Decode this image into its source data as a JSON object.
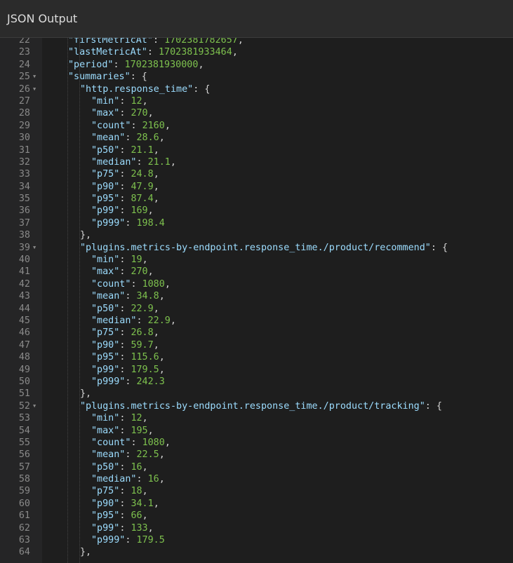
{
  "panel": {
    "title": "JSON Output"
  },
  "lines": [
    {
      "num": "22",
      "parts": [
        {
          "t": "\"firstMetricAt\"",
          "c": "k"
        },
        {
          "t": ": ",
          "c": "p"
        },
        {
          "t": "1702381782657",
          "c": "n"
        },
        {
          "t": ",",
          "c": "p"
        }
      ]
    },
    {
      "num": "23",
      "parts": [
        {
          "t": "\"lastMetricAt\"",
          "c": "k"
        },
        {
          "t": ": ",
          "c": "p"
        },
        {
          "t": "1702381933464",
          "c": "n"
        },
        {
          "t": ",",
          "c": "p"
        }
      ]
    },
    {
      "num": "24",
      "parts": [
        {
          "t": "\"period\"",
          "c": "k"
        },
        {
          "t": ": ",
          "c": "p"
        },
        {
          "t": "1702381930000",
          "c": "n"
        },
        {
          "t": ",",
          "c": "p"
        }
      ]
    },
    {
      "num": "25",
      "fold": true,
      "parts": [
        {
          "t": "\"summaries\"",
          "c": "k"
        },
        {
          "t": ": {",
          "c": "p"
        }
      ]
    },
    {
      "num": "26",
      "fold": true,
      "parts": [
        {
          "t": "\"http.response_time\"",
          "c": "k"
        },
        {
          "t": ": {",
          "c": "p"
        }
      ]
    },
    {
      "num": "27",
      "parts": [
        {
          "t": "\"min\"",
          "c": "k"
        },
        {
          "t": ": ",
          "c": "p"
        },
        {
          "t": "12",
          "c": "n"
        },
        {
          "t": ",",
          "c": "p"
        }
      ]
    },
    {
      "num": "28",
      "parts": [
        {
          "t": "\"max\"",
          "c": "k"
        },
        {
          "t": ": ",
          "c": "p"
        },
        {
          "t": "270",
          "c": "n"
        },
        {
          "t": ",",
          "c": "p"
        }
      ]
    },
    {
      "num": "29",
      "parts": [
        {
          "t": "\"count\"",
          "c": "k"
        },
        {
          "t": ": ",
          "c": "p"
        },
        {
          "t": "2160",
          "c": "n"
        },
        {
          "t": ",",
          "c": "p"
        }
      ]
    },
    {
      "num": "30",
      "parts": [
        {
          "t": "\"mean\"",
          "c": "k"
        },
        {
          "t": ": ",
          "c": "p"
        },
        {
          "t": "28.6",
          "c": "n"
        },
        {
          "t": ",",
          "c": "p"
        }
      ]
    },
    {
      "num": "31",
      "parts": [
        {
          "t": "\"p50\"",
          "c": "k"
        },
        {
          "t": ": ",
          "c": "p"
        },
        {
          "t": "21.1",
          "c": "n"
        },
        {
          "t": ",",
          "c": "p"
        }
      ]
    },
    {
      "num": "32",
      "parts": [
        {
          "t": "\"median\"",
          "c": "k"
        },
        {
          "t": ": ",
          "c": "p"
        },
        {
          "t": "21.1",
          "c": "n"
        },
        {
          "t": ",",
          "c": "p"
        }
      ]
    },
    {
      "num": "33",
      "parts": [
        {
          "t": "\"p75\"",
          "c": "k"
        },
        {
          "t": ": ",
          "c": "p"
        },
        {
          "t": "24.8",
          "c": "n"
        },
        {
          "t": ",",
          "c": "p"
        }
      ]
    },
    {
      "num": "34",
      "parts": [
        {
          "t": "\"p90\"",
          "c": "k"
        },
        {
          "t": ": ",
          "c": "p"
        },
        {
          "t": "47.9",
          "c": "n"
        },
        {
          "t": ",",
          "c": "p"
        }
      ]
    },
    {
      "num": "35",
      "parts": [
        {
          "t": "\"p95\"",
          "c": "k"
        },
        {
          "t": ": ",
          "c": "p"
        },
        {
          "t": "87.4",
          "c": "n"
        },
        {
          "t": ",",
          "c": "p"
        }
      ]
    },
    {
      "num": "36",
      "parts": [
        {
          "t": "\"p99\"",
          "c": "k"
        },
        {
          "t": ": ",
          "c": "p"
        },
        {
          "t": "169",
          "c": "n"
        },
        {
          "t": ",",
          "c": "p"
        }
      ]
    },
    {
      "num": "37",
      "parts": [
        {
          "t": "\"p999\"",
          "c": "k"
        },
        {
          "t": ": ",
          "c": "p"
        },
        {
          "t": "198.4",
          "c": "n"
        }
      ]
    },
    {
      "num": "38",
      "parts": [
        {
          "t": "},",
          "c": "p"
        }
      ]
    },
    {
      "num": "39",
      "fold": true,
      "parts": [
        {
          "t": "\"plugins.metrics-by-endpoint.response_time./product/recommend\"",
          "c": "k"
        },
        {
          "t": ": {",
          "c": "p"
        }
      ]
    },
    {
      "num": "40",
      "parts": [
        {
          "t": "\"min\"",
          "c": "k"
        },
        {
          "t": ": ",
          "c": "p"
        },
        {
          "t": "19",
          "c": "n"
        },
        {
          "t": ",",
          "c": "p"
        }
      ]
    },
    {
      "num": "41",
      "parts": [
        {
          "t": "\"max\"",
          "c": "k"
        },
        {
          "t": ": ",
          "c": "p"
        },
        {
          "t": "270",
          "c": "n"
        },
        {
          "t": ",",
          "c": "p"
        }
      ]
    },
    {
      "num": "42",
      "parts": [
        {
          "t": "\"count\"",
          "c": "k"
        },
        {
          "t": ": ",
          "c": "p"
        },
        {
          "t": "1080",
          "c": "n"
        },
        {
          "t": ",",
          "c": "p"
        }
      ]
    },
    {
      "num": "43",
      "parts": [
        {
          "t": "\"mean\"",
          "c": "k"
        },
        {
          "t": ": ",
          "c": "p"
        },
        {
          "t": "34.8",
          "c": "n"
        },
        {
          "t": ",",
          "c": "p"
        }
      ]
    },
    {
      "num": "44",
      "parts": [
        {
          "t": "\"p50\"",
          "c": "k"
        },
        {
          "t": ": ",
          "c": "p"
        },
        {
          "t": "22.9",
          "c": "n"
        },
        {
          "t": ",",
          "c": "p"
        }
      ]
    },
    {
      "num": "45",
      "parts": [
        {
          "t": "\"median\"",
          "c": "k"
        },
        {
          "t": ": ",
          "c": "p"
        },
        {
          "t": "22.9",
          "c": "n"
        },
        {
          "t": ",",
          "c": "p"
        }
      ]
    },
    {
      "num": "46",
      "parts": [
        {
          "t": "\"p75\"",
          "c": "k"
        },
        {
          "t": ": ",
          "c": "p"
        },
        {
          "t": "26.8",
          "c": "n"
        },
        {
          "t": ",",
          "c": "p"
        }
      ]
    },
    {
      "num": "47",
      "parts": [
        {
          "t": "\"p90\"",
          "c": "k"
        },
        {
          "t": ": ",
          "c": "p"
        },
        {
          "t": "59.7",
          "c": "n"
        },
        {
          "t": ",",
          "c": "p"
        }
      ]
    },
    {
      "num": "48",
      "parts": [
        {
          "t": "\"p95\"",
          "c": "k"
        },
        {
          "t": ": ",
          "c": "p"
        },
        {
          "t": "115.6",
          "c": "n"
        },
        {
          "t": ",",
          "c": "p"
        }
      ]
    },
    {
      "num": "49",
      "parts": [
        {
          "t": "\"p99\"",
          "c": "k"
        },
        {
          "t": ": ",
          "c": "p"
        },
        {
          "t": "179.5",
          "c": "n"
        },
        {
          "t": ",",
          "c": "p"
        }
      ]
    },
    {
      "num": "50",
      "parts": [
        {
          "t": "\"p999\"",
          "c": "k"
        },
        {
          "t": ": ",
          "c": "p"
        },
        {
          "t": "242.3",
          "c": "n"
        }
      ]
    },
    {
      "num": "51",
      "parts": [
        {
          "t": "},",
          "c": "p"
        }
      ]
    },
    {
      "num": "52",
      "fold": true,
      "parts": [
        {
          "t": "\"plugins.metrics-by-endpoint.response_time./product/tracking\"",
          "c": "k"
        },
        {
          "t": ": {",
          "c": "p"
        }
      ]
    },
    {
      "num": "53",
      "parts": [
        {
          "t": "\"min\"",
          "c": "k"
        },
        {
          "t": ": ",
          "c": "p"
        },
        {
          "t": "12",
          "c": "n"
        },
        {
          "t": ",",
          "c": "p"
        }
      ]
    },
    {
      "num": "54",
      "parts": [
        {
          "t": "\"max\"",
          "c": "k"
        },
        {
          "t": ": ",
          "c": "p"
        },
        {
          "t": "195",
          "c": "n"
        },
        {
          "t": ",",
          "c": "p"
        }
      ]
    },
    {
      "num": "55",
      "parts": [
        {
          "t": "\"count\"",
          "c": "k"
        },
        {
          "t": ": ",
          "c": "p"
        },
        {
          "t": "1080",
          "c": "n"
        },
        {
          "t": ",",
          "c": "p"
        }
      ]
    },
    {
      "num": "56",
      "parts": [
        {
          "t": "\"mean\"",
          "c": "k"
        },
        {
          "t": ": ",
          "c": "p"
        },
        {
          "t": "22.5",
          "c": "n"
        },
        {
          "t": ",",
          "c": "p"
        }
      ]
    },
    {
      "num": "57",
      "parts": [
        {
          "t": "\"p50\"",
          "c": "k"
        },
        {
          "t": ": ",
          "c": "p"
        },
        {
          "t": "16",
          "c": "n"
        },
        {
          "t": ",",
          "c": "p"
        }
      ]
    },
    {
      "num": "58",
      "parts": [
        {
          "t": "\"median\"",
          "c": "k"
        },
        {
          "t": ": ",
          "c": "p"
        },
        {
          "t": "16",
          "c": "n"
        },
        {
          "t": ",",
          "c": "p"
        }
      ]
    },
    {
      "num": "59",
      "parts": [
        {
          "t": "\"p75\"",
          "c": "k"
        },
        {
          "t": ": ",
          "c": "p"
        },
        {
          "t": "18",
          "c": "n"
        },
        {
          "t": ",",
          "c": "p"
        }
      ]
    },
    {
      "num": "60",
      "parts": [
        {
          "t": "\"p90\"",
          "c": "k"
        },
        {
          "t": ": ",
          "c": "p"
        },
        {
          "t": "34.1",
          "c": "n"
        },
        {
          "t": ",",
          "c": "p"
        }
      ]
    },
    {
      "num": "61",
      "parts": [
        {
          "t": "\"p95\"",
          "c": "k"
        },
        {
          "t": ": ",
          "c": "p"
        },
        {
          "t": "66",
          "c": "n"
        },
        {
          "t": ",",
          "c": "p"
        }
      ]
    },
    {
      "num": "62",
      "parts": [
        {
          "t": "\"p99\"",
          "c": "k"
        },
        {
          "t": ": ",
          "c": "p"
        },
        {
          "t": "133",
          "c": "n"
        },
        {
          "t": ",",
          "c": "p"
        }
      ]
    },
    {
      "num": "63",
      "parts": [
        {
          "t": "\"p999\"",
          "c": "k"
        },
        {
          "t": ": ",
          "c": "p"
        },
        {
          "t": "179.5",
          "c": "n"
        }
      ]
    },
    {
      "num": "64",
      "parts": [
        {
          "t": "},",
          "c": "p"
        }
      ]
    }
  ]
}
